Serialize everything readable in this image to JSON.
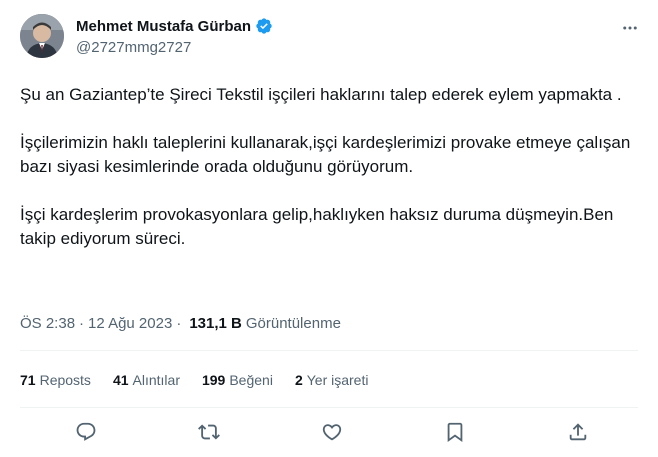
{
  "author": {
    "name": "Mehmet Mustafa Gürban",
    "handle": "@2727mmg2727",
    "verified_color": "#1d9bf0"
  },
  "tweet": {
    "paragraphs": [
      "Şu an Gaziantep’te Şireci Tekstil işçileri haklarını talep ederek eylem yapmakta .",
      "İşçilerimizin haklı taleplerini kullanarak,işçi kardeşlerimizi provake etmeye çalışan bazı siyasi kesimlerinde orada olduğunu görüyorum.",
      "İşçi kardeşlerim provokasyonlara gelip,haklıyken haksız duruma düşmeyin.Ben takip ediyorum süreci."
    ],
    "time": "ÖS 2:38",
    "separator": "·",
    "date": "12 Ağu 2023",
    "views_count": "131,1 B",
    "views_label": "Görüntülenme"
  },
  "stats": [
    {
      "count": "71",
      "label": "Reposts"
    },
    {
      "count": "41",
      "label": "Alıntılar"
    },
    {
      "count": "199",
      "label": "Beğeni"
    },
    {
      "count": "2",
      "label": "Yer işareti"
    }
  ],
  "actions": [
    {
      "icon": "reply-icon"
    },
    {
      "icon": "repost-icon"
    },
    {
      "icon": "like-icon"
    },
    {
      "icon": "bookmark-icon"
    },
    {
      "icon": "share-icon"
    }
  ],
  "colors": {
    "text": "#0f1419",
    "secondary": "#536471",
    "divider": "#eff3f4"
  }
}
